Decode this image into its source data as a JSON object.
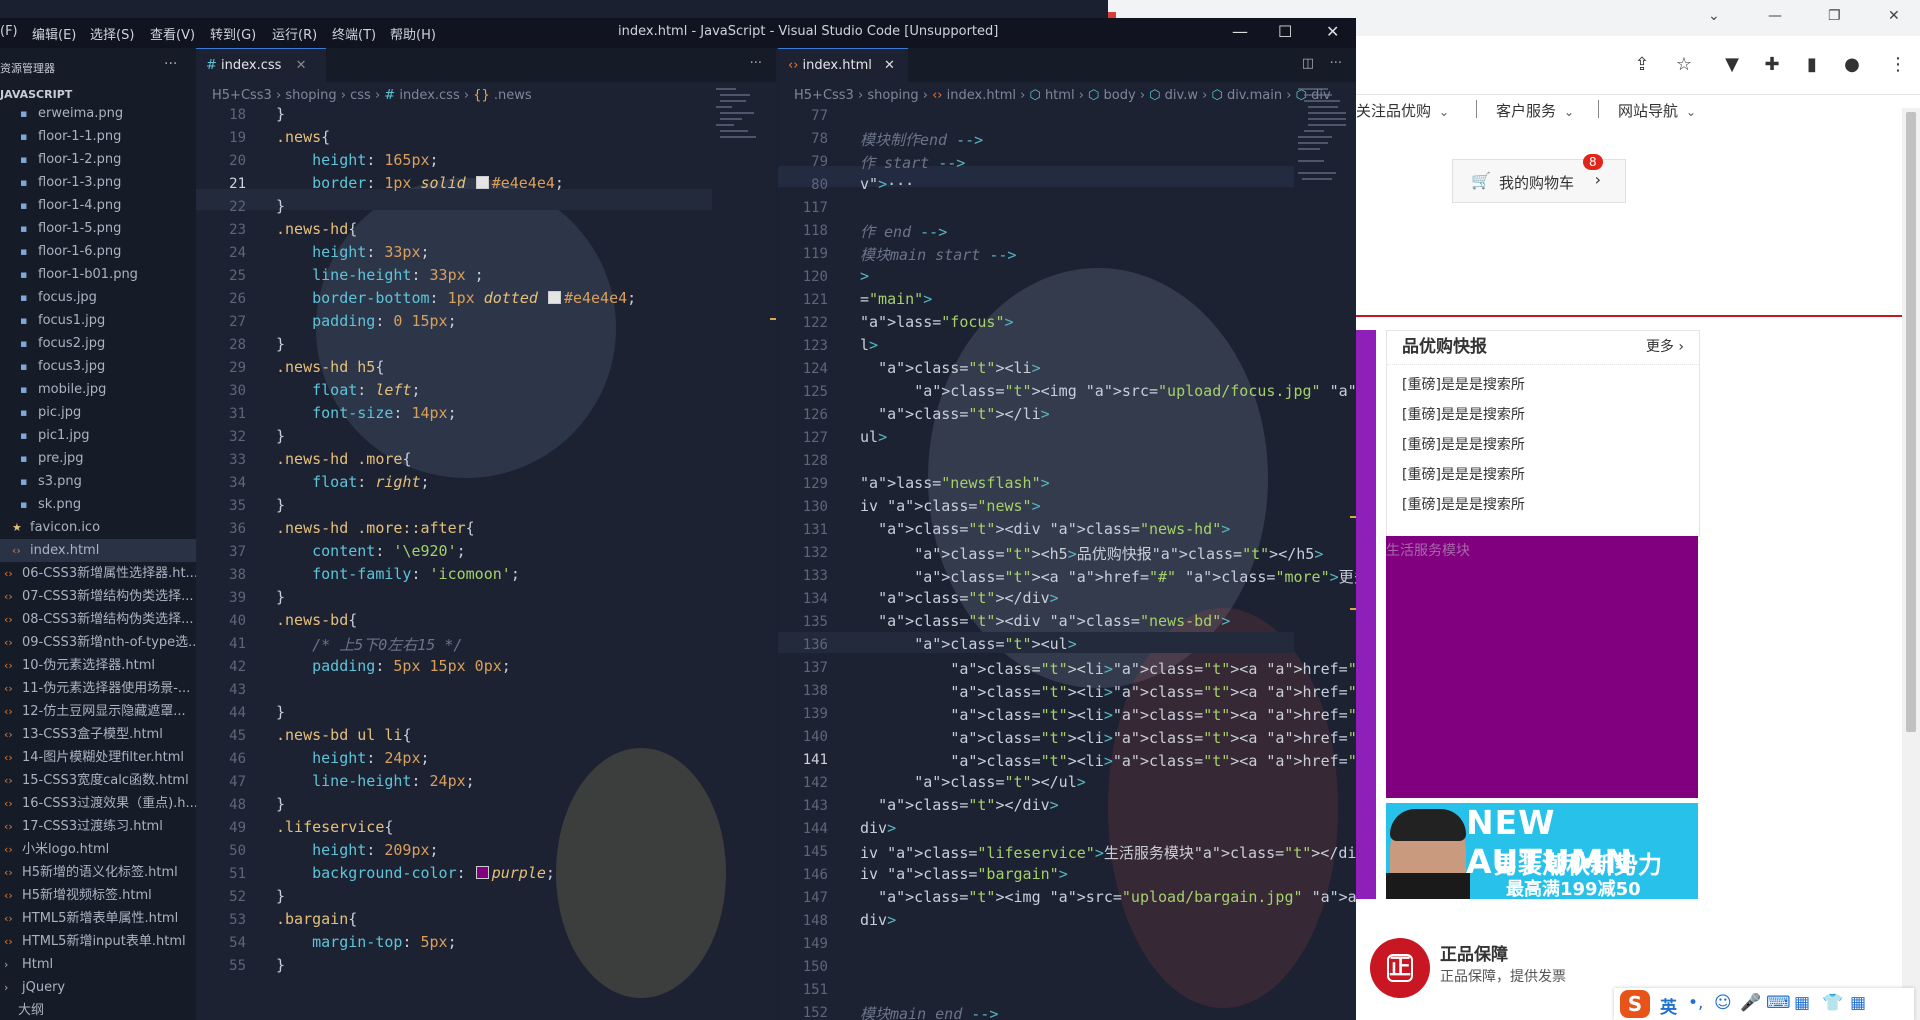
{
  "browser": {
    "shortcuts": [
      "关注品优购",
      "客户服务",
      "网站导航"
    ],
    "cart": {
      "label": "我的购物车",
      "count": "8"
    },
    "news": {
      "title": "品优购快报",
      "more": "更多",
      "items": [
        "[重磅]是是是搜索所",
        "[重磅]是是是搜索所",
        "[重磅]是是是搜索所",
        "[重磅]是是是搜索所",
        "[重磅]是是是搜索所"
      ]
    },
    "lifeservice_text": "生活服务模块",
    "bargain": {
      "line1": "NEW AUTUMN",
      "line2": "男装潮秋新势力",
      "line3": "最高满199减50"
    },
    "guarantee": {
      "title": "正品保障",
      "desc": "正品保障，提供发票",
      "badge": "正"
    },
    "ime": {
      "lang": "英"
    }
  },
  "vscode": {
    "title": "index.html - JavaScript - Visual Studio Code [Unsupported]",
    "menu": [
      "(F)",
      "编辑(E)",
      "选择(S)",
      "查看(V)",
      "转到(G)",
      "运行(R)",
      "终端(T)",
      "帮助(H)"
    ],
    "sidebar": {
      "header": "资源管理器",
      "section": "JAVASCRIPT",
      "files": [
        "erweima.png",
        "floor-1-1.png",
        "floor-1-2.png",
        "floor-1-3.png",
        "floor-1-4.png",
        "floor-1-5.png",
        "floor-1-6.png",
        "floor-1-b01.png",
        "focus.jpg",
        "focus1.jpg",
        "focus2.jpg",
        "focus3.jpg",
        "mobile.jpg",
        "pic.jpg",
        "pic1.jpg",
        "pre.jpg",
        "s3.png",
        "sk.png"
      ],
      "favicon": "favicon.ico",
      "index": "index.html",
      "docs": [
        "06-CSS3新增属性选择器.ht...",
        "07-CSS3新增结构伪类选择...",
        "08-CSS3新增结构伪类选择...",
        "09-CSS3新增nth-of-type选...",
        "10-伪元素选择器.html",
        "11-伪元素选择器使用场景-...",
        "12-仿土豆网显示隐藏遮罩...",
        "13-CSS3盒子模型.html",
        "14-图片模糊处理filter.html",
        "15-CSS3宽度calc函数.html",
        "16-CSS3过渡效果（重点).h...",
        "17-CSS3过渡练习.html",
        "小米logo.html",
        "H5新增的语义化标签.html",
        "H5新增视频标签.html",
        "HTML5新增表单属性.html",
        "HTML5新增input表单.html"
      ],
      "folders": [
        "Html",
        "jQuery"
      ],
      "outline": "大纲"
    },
    "left": {
      "tab": "index.css",
      "breadcrumb": [
        "H5+Css3",
        "shoping",
        "css",
        "index.css",
        ".news"
      ],
      "lines": [
        "18",
        "19",
        "20",
        "21",
        "22",
        "23",
        "24",
        "25",
        "26",
        "27",
        "28",
        "29",
        "30",
        "31",
        "32",
        "33",
        "34",
        "35",
        "36",
        "37",
        "38",
        "39",
        "40",
        "41",
        "42",
        "43",
        "44",
        "45",
        "46",
        "47",
        "48",
        "49",
        "50",
        "51",
        "52",
        "53",
        "54",
        "55"
      ],
      "current_line": "21",
      "code": {
        "l18": "}",
        "l19_sel": ".news",
        "l20_prop": "height",
        "l20_val": "165px",
        "l21_prop": "border",
        "l21_num": "1px",
        "l21_style": "solid",
        "l21_color": "#e4e4e4",
        "l23_sel": ".news-hd",
        "l24_prop": "height",
        "l24_val": "33px",
        "l25_prop": "line-height",
        "l25_val": "33px",
        "l26_prop": "border-bottom",
        "l26_num": "1px",
        "l26_style": "dotted",
        "l26_color": "#e4e4e4",
        "l27_prop": "padding",
        "l27_val": "0 15px",
        "l29_sel": ".news-hd h5",
        "l30_prop": "float",
        "l30_val": "left",
        "l31_prop": "font-size",
        "l31_val": "14px",
        "l33_sel": ".news-hd .more",
        "l34_prop": "float",
        "l34_val": "right",
        "l36_sel": ".news-hd .more::after",
        "l37_prop": "content",
        "l37_val": "'\\e920'",
        "l38_prop": "font-family",
        "l38_val": "'icomoon'",
        "l40_sel": ".news-bd",
        "l41_comment": "/* 上5下0左右15 */",
        "l42_prop": "padding",
        "l42_val": "5px 15px 0px",
        "l45_sel": ".news-bd ul li",
        "l46_prop": "height",
        "l46_val": "24px",
        "l47_prop": "line-height",
        "l47_val": "24px",
        "l49_sel": ".lifeservice",
        "l50_prop": "height",
        "l50_val": "209px",
        "l51_prop": "background-color",
        "l51_val": "purple",
        "l53_sel": ".bargain",
        "l54_prop": "margin-top",
        "l54_val": "5px"
      }
    },
    "right": {
      "tab": "index.html",
      "breadcrumb": [
        "H5+Css3",
        "shoping",
        "index.html",
        "html",
        "body",
        "div.w",
        "div.main",
        "div"
      ],
      "lines": [
        "77",
        "78",
        "79",
        "80",
        "117",
        "118",
        "119",
        "120",
        "121",
        "122",
        "123",
        "124",
        "125",
        "126",
        "127",
        "128",
        "129",
        "130",
        "131",
        "132",
        "133",
        "134",
        "135",
        "136",
        "137",
        "138",
        "139",
        "140",
        "141",
        "142",
        "143",
        "144",
        "145",
        "146",
        "147",
        "148",
        "149",
        "150",
        "151",
        "152"
      ],
      "current_line": "141",
      "code": [
        "",
        "模块制作end -->",
        "作 start -->",
        "v\">···",
        "",
        "作 end -->",
        "模块main start -->",
        ">",
        "=\"main\">",
        "lass=\"focus\">",
        "l>",
        "  <li>",
        "      <img src=\"upload/focus.jpg\" alt=\"\">",
        "  </li>",
        "ul>",
        "",
        "lass=\"newsflash\">",
        "iv class=\"news\">",
        "  <div class=\"news-hd\">",
        "      <h5>品优购快报</h5>",
        "      <a href=\"#\" class=\"more\">更多</a>",
        "  </div>",
        "  <div class=\"news-bd\">",
        "      <ul>",
        "          <li><a href=\"#\"><strong>[重磅]</strong",
        "          <li><a href=\"#\"><strong>[重磅]</strong",
        "          <li><a href=\"#\"><strong>[重磅]</strong",
        "          <li><a href=\"#\"><strong>[重磅]</strong",
        "          <li><a href=\"#\"><strong>[重磅]</strong",
        "      </ul>",
        "  </div>",
        "div>",
        "iv class=\"lifeservice\">生活服务模块</div>",
        "iv class=\"bargain\">",
        "  <img src=\"upload/bargain.jpg\" alt=\"\">",
        "div>",
        "",
        "",
        "",
        "模块main end -->"
      ]
    },
    "colors": {
      "accent": "#3b7bd6",
      "purple": "#800080",
      "border": "#e4e4e4"
    }
  }
}
